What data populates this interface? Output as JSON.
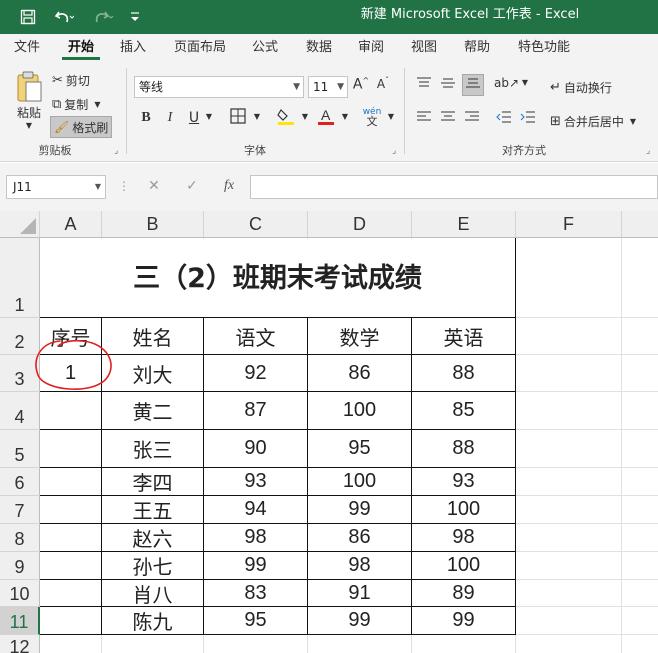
{
  "window": {
    "title": "新建 Microsoft Excel 工作表  -  Excel"
  },
  "quick_access": {
    "icons": [
      "save-icon",
      "undo-icon",
      "redo-icon",
      "customize-icon"
    ]
  },
  "tabs": [
    {
      "label": "文件"
    },
    {
      "label": "开始"
    },
    {
      "label": "插入"
    },
    {
      "label": "页面布局"
    },
    {
      "label": "公式"
    },
    {
      "label": "数据"
    },
    {
      "label": "审阅"
    },
    {
      "label": "视图"
    },
    {
      "label": "帮助"
    },
    {
      "label": "特色功能"
    }
  ],
  "active_tab": "开始",
  "ribbon": {
    "clipboard": {
      "paste": "粘贴",
      "cut": "剪切",
      "copy": "复制",
      "format_painter": "格式刷",
      "group_label": "剪贴板"
    },
    "font": {
      "font_name": "等线",
      "font_size": "11",
      "bold": "B",
      "italic": "I",
      "underline": "U",
      "phonetic": "wén",
      "group_label": "字体"
    },
    "alignment": {
      "wrap_text": "自动换行",
      "merge_center": "合并后居中",
      "group_label": "对齐方式"
    }
  },
  "formula_bar": {
    "name_box": "J11",
    "fx": "fx",
    "formula": ""
  },
  "grid": {
    "columns": [
      "A",
      "B",
      "C",
      "D",
      "E",
      "F"
    ],
    "rows": [
      "1",
      "2",
      "3",
      "4",
      "5",
      "6",
      "7",
      "8",
      "9",
      "10",
      "11",
      "12"
    ],
    "selected_row": "11"
  },
  "sheet": {
    "title": "三（2）班期末考试成绩",
    "headers": [
      "序号",
      "姓名",
      "语文",
      "数学",
      "英语"
    ],
    "records": [
      {
        "no": "1",
        "name": "刘大",
        "chinese": "92",
        "math": "86",
        "english": "88"
      },
      {
        "no": "",
        "name": "黄二",
        "chinese": "87",
        "math": "100",
        "english": "85"
      },
      {
        "no": "",
        "name": "张三",
        "chinese": "90",
        "math": "95",
        "english": "88"
      },
      {
        "no": "",
        "name": "李四",
        "chinese": "93",
        "math": "100",
        "english": "93"
      },
      {
        "no": "",
        "name": "王五",
        "chinese": "94",
        "math": "99",
        "english": "100"
      },
      {
        "no": "",
        "name": "赵六",
        "chinese": "98",
        "math": "86",
        "english": "98"
      },
      {
        "no": "",
        "name": "孙七",
        "chinese": "99",
        "math": "98",
        "english": "100"
      },
      {
        "no": "",
        "name": "肖八",
        "chinese": "83",
        "math": "91",
        "english": "89"
      },
      {
        "no": "",
        "name": "陈九",
        "chinese": "95",
        "math": "99",
        "english": "99"
      }
    ]
  },
  "colors": {
    "accent": "#217346",
    "annotation": "#e02020"
  }
}
